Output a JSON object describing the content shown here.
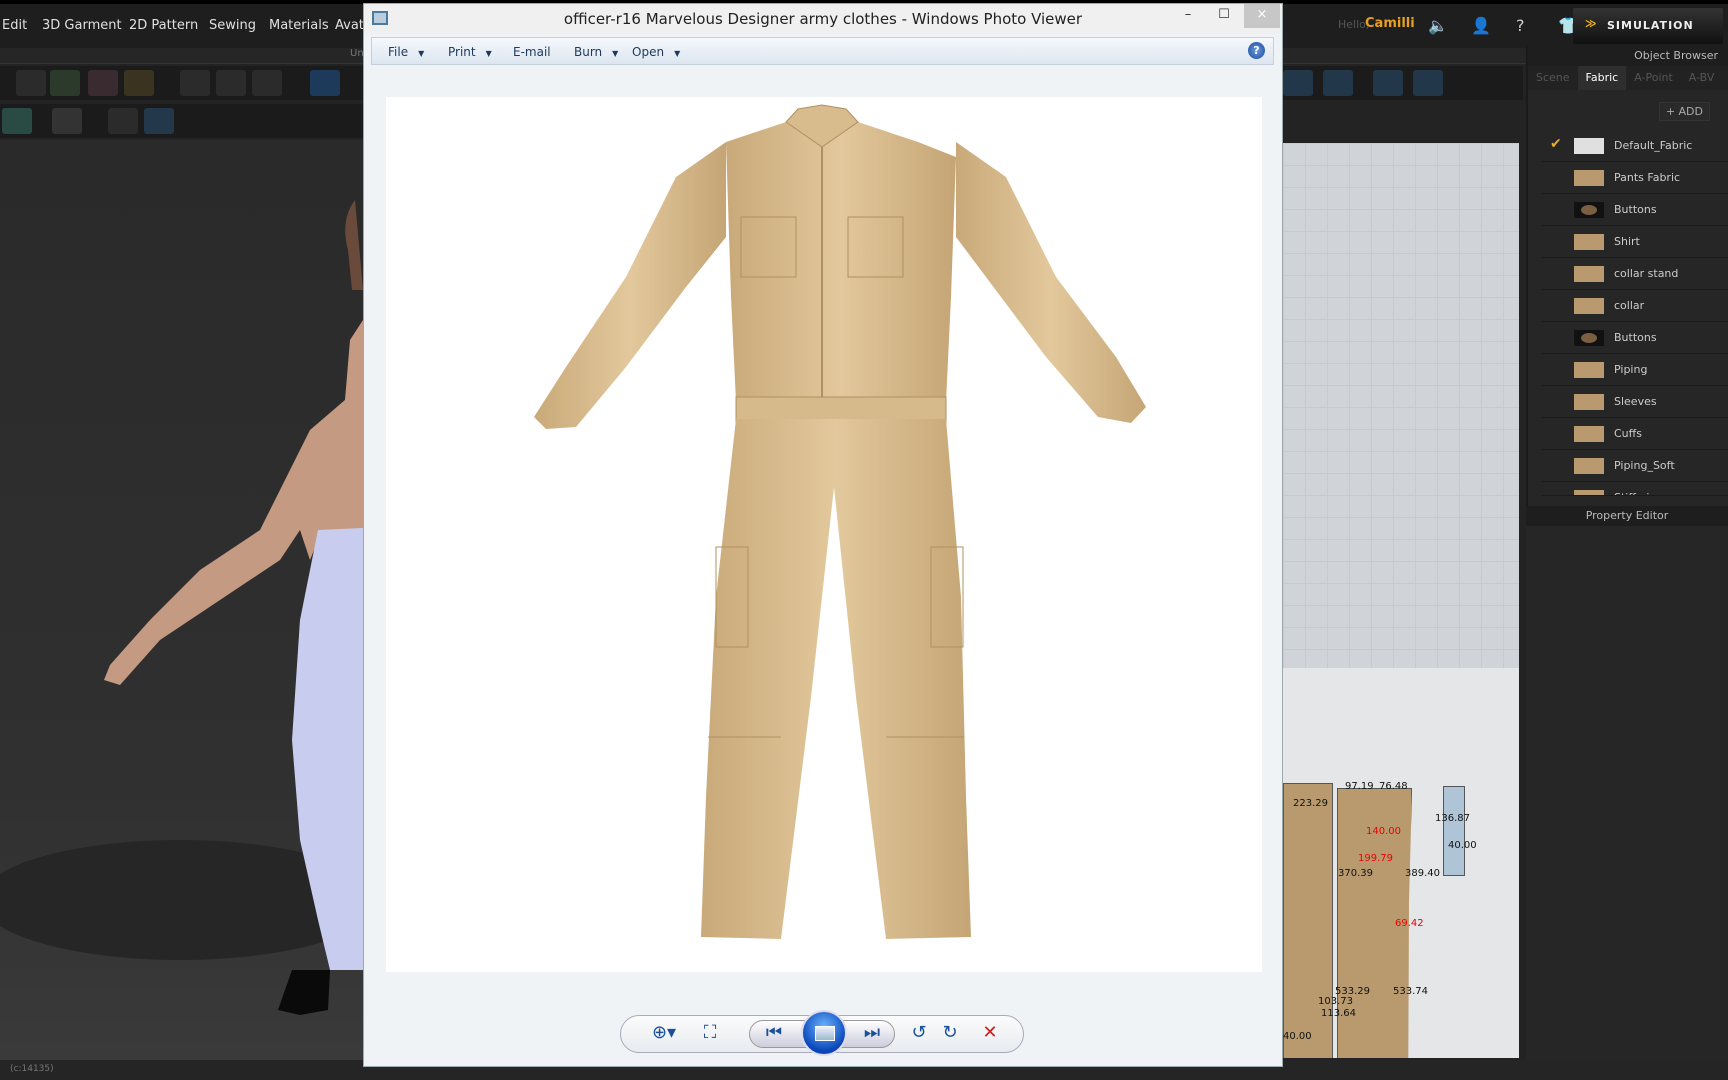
{
  "app": {
    "menu": [
      "Edit",
      "3D Garment",
      "2D Pattern",
      "Sewing",
      "Materials",
      "Avatar"
    ],
    "user_greeting": "Hello,",
    "user_name": "Camilli",
    "simulation_label": "SIMULATION",
    "status": "(c:14135)",
    "subbar_text": "Un"
  },
  "object_browser": {
    "title": "Object Browser",
    "tabs": [
      "Scene",
      "Fabric",
      "A-Point",
      "A-BV"
    ],
    "active_tab": "Fabric",
    "add_label": "+ ADD",
    "fabrics": [
      {
        "name": "Default_Fabric",
        "swatch": "white",
        "checked": true
      },
      {
        "name": "Pants Fabric",
        "swatch": "khaki"
      },
      {
        "name": "Buttons",
        "swatch": "button"
      },
      {
        "name": "Shirt",
        "swatch": "khaki"
      },
      {
        "name": "collar stand",
        "swatch": "khaki"
      },
      {
        "name": "collar",
        "swatch": "khaki"
      },
      {
        "name": "Buttons",
        "swatch": "button"
      },
      {
        "name": "Piping",
        "swatch": "khaki"
      },
      {
        "name": "Sleeves",
        "swatch": "khaki"
      },
      {
        "name": "Cuffs",
        "swatch": "khaki"
      },
      {
        "name": "Piping_Soft",
        "swatch": "khaki"
      },
      {
        "name": "Stiff piece on shoulder",
        "swatch": "khaki"
      }
    ]
  },
  "property_editor": {
    "title": "Property Editor"
  },
  "pattern_labels": [
    "97.19",
    "76.48",
    "223.29",
    "140.00",
    "199.79",
    "370.39",
    "389.40",
    "40.00",
    "533.74",
    "533.29",
    "103.73",
    "113.64",
    "69.42",
    "136.87",
    "40.00"
  ],
  "viewer": {
    "title": "officer-r16 Marvelous Designer army clothes - Windows Photo Viewer",
    "menu": [
      {
        "label": "File",
        "dropdown": true
      },
      {
        "label": "Print",
        "dropdown": true
      },
      {
        "label": "E-mail",
        "dropdown": false
      },
      {
        "label": "Burn",
        "dropdown": true
      },
      {
        "label": "Open",
        "dropdown": true
      }
    ],
    "window_controls": {
      "minimize": "–",
      "maximize": "☐",
      "close": "×"
    },
    "help": "?"
  },
  "colors": {
    "accent": "#e8a020",
    "khaki": "#d9bd8e",
    "viewer_bg": "#f0f3f6"
  }
}
